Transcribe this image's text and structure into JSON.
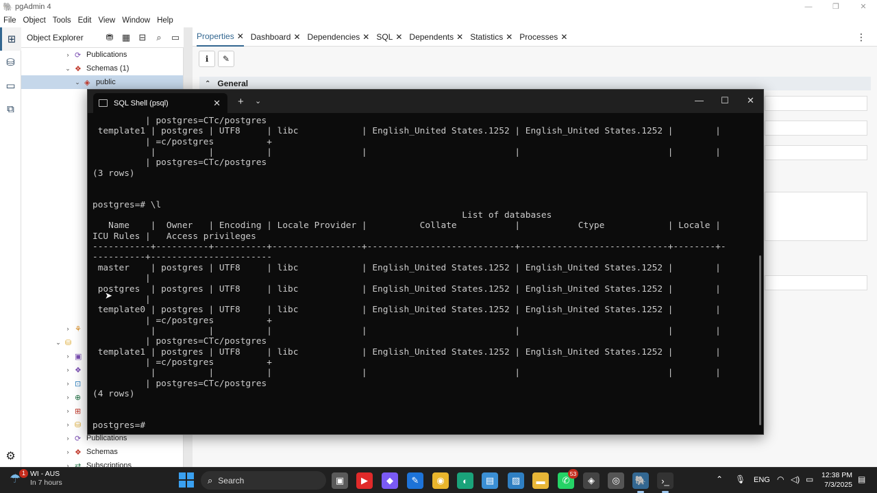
{
  "window": {
    "title": "pgAdmin 4",
    "controls": [
      "—",
      "❐",
      "✕"
    ]
  },
  "menu": [
    "File",
    "Object",
    "Tools",
    "Edit",
    "View",
    "Window",
    "Help"
  ],
  "object_explorer": {
    "title": "Object Explorer",
    "tree": [
      {
        "label": "Publications",
        "icon": "publications-icon",
        "chev": "›"
      },
      {
        "label": "Schemas (1)",
        "icon": "schemas-icon",
        "chev": "⌄"
      },
      {
        "label": "public",
        "icon": "schema-icon",
        "chev": "⌄"
      },
      {
        "label": "Publications",
        "icon": "publications-icon",
        "chev": "›"
      },
      {
        "label": "Schemas",
        "icon": "schemas-icon",
        "chev": "›"
      },
      {
        "label": "Subscriptions",
        "icon": "subscriptions-icon",
        "chev": "›"
      }
    ]
  },
  "tabs": [
    {
      "label": "Properties",
      "active": true
    },
    {
      "label": "Dashboard"
    },
    {
      "label": "Dependencies"
    },
    {
      "label": "SQL"
    },
    {
      "label": "Dependents"
    },
    {
      "label": "Statistics"
    },
    {
      "label": "Processes"
    }
  ],
  "properties": {
    "section": "General"
  },
  "terminal": {
    "tab_title": "SQL Shell (psql)",
    "lines": [
      "          | postgres=CTc/postgres",
      " template1 | postgres | UTF8     | libc            | English_United States.1252 | English_United States.1252 |        |",
      "          | =c/postgres          +",
      "           |          |          |                 |                            |                            |        |",
      "          | postgres=CTc/postgres",
      "(3 rows)",
      "",
      "",
      "postgres=# \\l",
      "                                                                      List of databases",
      "   Name    |  Owner   | Encoding | Locale Provider |          Collate           |           Ctype            | Locale |",
      "ICU Rules |   Access privileges",
      "-----------+----------+----------+-----------------+----------------------------+----------------------------+--------+-",
      "----------+-----------------------",
      " master    | postgres | UTF8     | libc            | English_United States.1252 | English_United States.1252 |        |",
      "          |",
      " postgres  | postgres | UTF8     | libc            | English_United States.1252 | English_United States.1252 |        |",
      "          |",
      " template0 | postgres | UTF8     | libc            | English_United States.1252 | English_United States.1252 |        |",
      "          | =c/postgres          +",
      "           |          |          |                 |                            |                            |        |",
      "          | postgres=CTc/postgres",
      " template1 | postgres | UTF8     | libc            | English_United States.1252 | English_United States.1252 |        |",
      "          | =c/postgres          +",
      "           |          |          |                 |                            |                            |        |",
      "          | postgres=CTc/postgres",
      "(4 rows)",
      "",
      "",
      "postgres=#"
    ]
  },
  "taskbar": {
    "weather": {
      "line1": "WI - AUS",
      "line2": "In 7 hours",
      "badge": "1"
    },
    "search_placeholder": "Search",
    "apps": [
      {
        "name": "task-view-icon",
        "color": "#5a5a5a"
      },
      {
        "name": "youtube-icon",
        "color": "#e02a2a"
      },
      {
        "name": "copilot-icon",
        "color": "#7a5af5"
      },
      {
        "name": "editor-icon",
        "color": "#1d73d8"
      },
      {
        "name": "chrome-icon",
        "color": "#e9b52c"
      },
      {
        "name": "edge-icon",
        "color": "#1aa37a"
      },
      {
        "name": "store-icon",
        "color": "#3b8fd4"
      },
      {
        "name": "photos-icon",
        "color": "#2f7fc2"
      },
      {
        "name": "file-explorer-icon",
        "color": "#e8b637"
      },
      {
        "name": "whatsapp-icon",
        "color": "#25d366",
        "badge": "53"
      },
      {
        "name": "app-icon",
        "color": "#444444"
      },
      {
        "name": "recorder-icon",
        "color": "#555555"
      },
      {
        "name": "pgadmin-icon",
        "color": "#336791",
        "active": true
      },
      {
        "name": "terminal-icon",
        "color": "#333333",
        "active": true
      }
    ],
    "lang": "ENG",
    "time": "12:38 PM",
    "date": "7/3/2025"
  }
}
